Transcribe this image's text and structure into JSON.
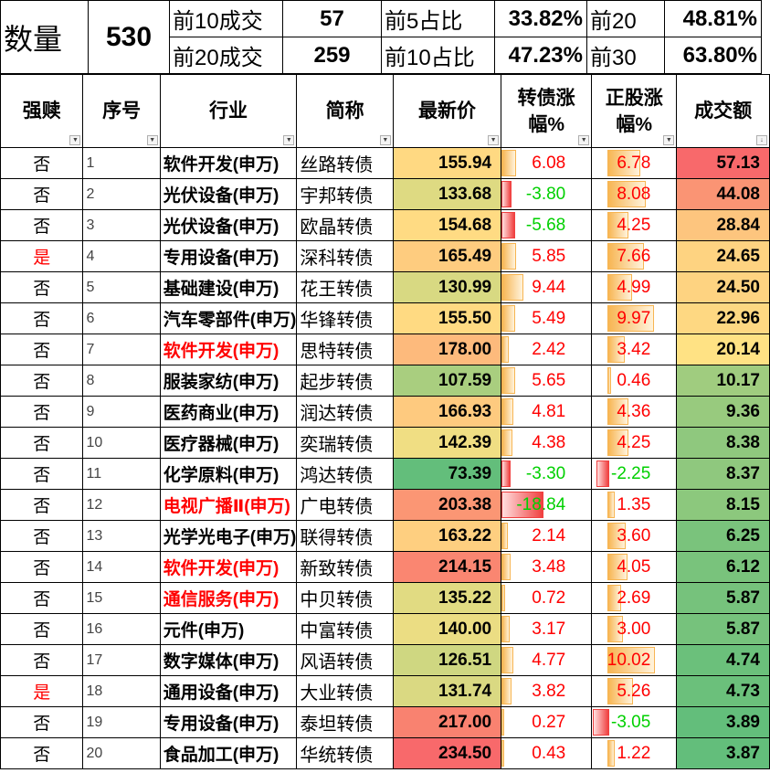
{
  "summary": {
    "count_label": "数量",
    "count_value": "530",
    "rows": [
      {
        "a_label": "前10成交",
        "a_value": "57",
        "b_label": "前5占比",
        "b_value": "33.82%",
        "c_label": "前20",
        "c_value": "48.81%"
      },
      {
        "a_label": "前20成交",
        "a_value": "259",
        "b_label": "前10占比",
        "b_value": "47.23%",
        "c_label": "前30",
        "c_value": "63.80%"
      }
    ]
  },
  "headers": {
    "redeem": "强赎",
    "seq": "序号",
    "industry": "行业",
    "name": "简称",
    "price": "最新价",
    "bond_chg_1": "转债涨",
    "bond_chg_2": "幅%",
    "stock_chg_1": "正股涨",
    "stock_chg_2": "幅%",
    "amount": "成交额"
  },
  "colors": {
    "positive_text": "#ff0000",
    "negative_text": "#00d000",
    "bar_positive": "#f7b552",
    "bar_negative": "#f04040",
    "scale_low": "#63be7b",
    "scale_mid": "#ffe284",
    "scale_high": "#f8696b"
  },
  "rows": [
    {
      "redeem": "否",
      "seq": "1",
      "industry": "软件开发(申万)",
      "industry_red": false,
      "name": "丝路转债",
      "price": "155.94",
      "bond_chg": "6.08",
      "stock_chg": "6.78",
      "amount": "57.13"
    },
    {
      "redeem": "否",
      "seq": "2",
      "industry": "光伏设备(申万)",
      "industry_red": false,
      "name": "宇邦转债",
      "price": "133.68",
      "bond_chg": "-3.80",
      "stock_chg": "8.08",
      "amount": "44.08"
    },
    {
      "redeem": "否",
      "seq": "3",
      "industry": "光伏设备(申万)",
      "industry_red": false,
      "name": "欧晶转债",
      "price": "154.68",
      "bond_chg": "-5.68",
      "stock_chg": "4.25",
      "amount": "28.84"
    },
    {
      "redeem": "是",
      "seq": "4",
      "industry": "专用设备(申万)",
      "industry_red": false,
      "name": "深科转债",
      "price": "165.49",
      "bond_chg": "5.85",
      "stock_chg": "7.66",
      "amount": "24.65"
    },
    {
      "redeem": "否",
      "seq": "5",
      "industry": "基础建设(申万)",
      "industry_red": false,
      "name": "花王转债",
      "price": "130.99",
      "bond_chg": "9.44",
      "stock_chg": "4.99",
      "amount": "24.50"
    },
    {
      "redeem": "否",
      "seq": "6",
      "industry": "汽车零部件(申万)",
      "industry_red": false,
      "name": "华锋转债",
      "price": "155.50",
      "bond_chg": "5.49",
      "stock_chg": "9.97",
      "amount": "22.96"
    },
    {
      "redeem": "否",
      "seq": "7",
      "industry": "软件开发(申万)",
      "industry_red": true,
      "name": "思特转债",
      "price": "178.00",
      "bond_chg": "2.42",
      "stock_chg": "3.42",
      "amount": "20.14"
    },
    {
      "redeem": "否",
      "seq": "8",
      "industry": "服装家纺(申万)",
      "industry_red": false,
      "name": "起步转债",
      "price": "107.59",
      "bond_chg": "5.65",
      "stock_chg": "0.46",
      "amount": "10.17"
    },
    {
      "redeem": "否",
      "seq": "9",
      "industry": "医药商业(申万)",
      "industry_red": false,
      "name": "润达转债",
      "price": "166.93",
      "bond_chg": "4.81",
      "stock_chg": "4.36",
      "amount": "9.36"
    },
    {
      "redeem": "否",
      "seq": "10",
      "industry": "医疗器械(申万)",
      "industry_red": false,
      "name": "奕瑞转债",
      "price": "142.39",
      "bond_chg": "4.38",
      "stock_chg": "4.25",
      "amount": "8.38"
    },
    {
      "redeem": "否",
      "seq": "11",
      "industry": "化学原料(申万)",
      "industry_red": false,
      "name": "鸿达转债",
      "price": "73.39",
      "bond_chg": "-3.30",
      "stock_chg": "-2.25",
      "amount": "8.37"
    },
    {
      "redeem": "否",
      "seq": "12",
      "industry": "电视广播Ⅱ(申万)",
      "industry_red": true,
      "name": "广电转债",
      "price": "203.38",
      "bond_chg": "-18.84",
      "stock_chg": "1.35",
      "amount": "8.15"
    },
    {
      "redeem": "否",
      "seq": "13",
      "industry": "光学光电子(申万)",
      "industry_red": false,
      "name": "联得转债",
      "price": "163.22",
      "bond_chg": "2.14",
      "stock_chg": "3.60",
      "amount": "6.25"
    },
    {
      "redeem": "否",
      "seq": "14",
      "industry": "软件开发(申万)",
      "industry_red": true,
      "name": "新致转债",
      "price": "214.15",
      "bond_chg": "3.48",
      "stock_chg": "4.05",
      "amount": "6.12"
    },
    {
      "redeem": "否",
      "seq": "15",
      "industry": "通信服务(申万)",
      "industry_red": true,
      "name": "中贝转债",
      "price": "135.22",
      "bond_chg": "0.72",
      "stock_chg": "2.69",
      "amount": "5.87"
    },
    {
      "redeem": "否",
      "seq": "16",
      "industry": "元件(申万)",
      "industry_red": false,
      "name": "中富转债",
      "price": "140.00",
      "bond_chg": "3.17",
      "stock_chg": "3.00",
      "amount": "5.87"
    },
    {
      "redeem": "否",
      "seq": "17",
      "industry": "数字媒体(申万)",
      "industry_red": false,
      "name": "风语转债",
      "price": "126.51",
      "bond_chg": "4.77",
      "stock_chg": "10.02",
      "amount": "4.74"
    },
    {
      "redeem": "是",
      "seq": "18",
      "industry": "通用设备(申万)",
      "industry_red": false,
      "name": "大业转债",
      "price": "131.74",
      "bond_chg": "3.82",
      "stock_chg": "5.26",
      "amount": "4.73"
    },
    {
      "redeem": "否",
      "seq": "19",
      "industry": "专用设备(申万)",
      "industry_red": false,
      "name": "泰坦转债",
      "price": "217.00",
      "bond_chg": "0.27",
      "stock_chg": "-3.05",
      "amount": "3.89"
    },
    {
      "redeem": "否",
      "seq": "20",
      "industry": "食品加工(申万)",
      "industry_red": false,
      "name": "华统转债",
      "price": "234.50",
      "bond_chg": "0.43",
      "stock_chg": "1.22",
      "amount": "3.87"
    }
  ]
}
